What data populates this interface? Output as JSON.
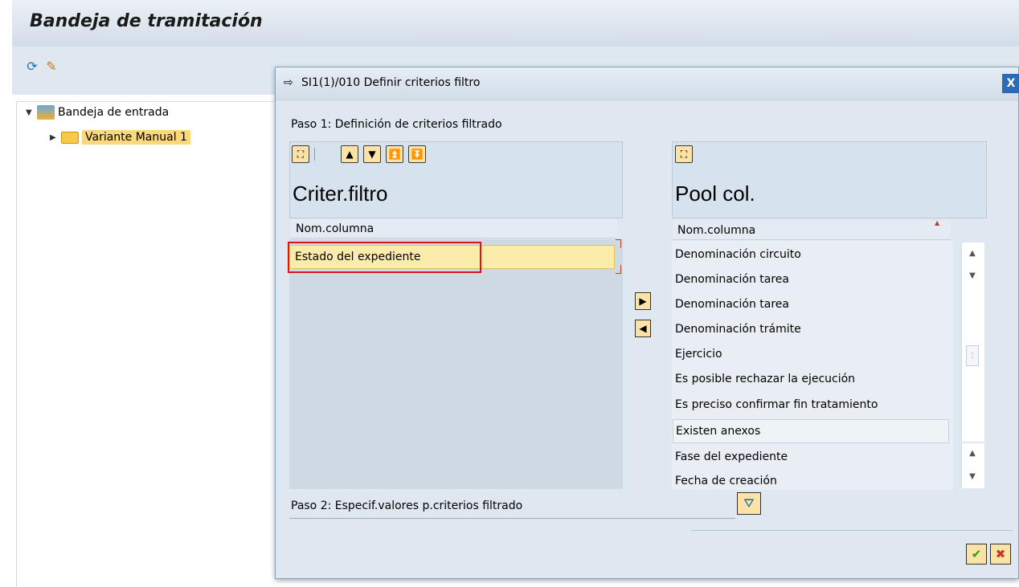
{
  "screen": {
    "title": "Bandeja de tramitación",
    "toolbar": {
      "refresh_icon": "refresh-icon",
      "edit_icon": "edit-pencil-icon"
    }
  },
  "tree": {
    "root_label": "Bandeja de entrada",
    "child_label": "Variante Manual 1"
  },
  "dialog": {
    "title": "SI1(1)/010 Definir criterios filtro",
    "close_label": "X",
    "step1_label": "Paso 1: Definición de criterios filtrado",
    "left_panel": {
      "title": "Criter.filtro",
      "column_header": "Nom.columna",
      "rows": [
        "Estado del expediente"
      ]
    },
    "right_panel": {
      "title": "Pool col.",
      "column_header": "Nom.columna",
      "rows": [
        "Denominación circuito",
        "Denominación tarea",
        "Denominación tarea",
        "Denominación trámite",
        "Ejercicio",
        "Es posible rechazar la ejecución",
        "Es preciso confirmar fin tratamiento",
        "Existen anexos",
        "Fase del expediente",
        "Fecha de creación"
      ]
    },
    "step2_label": "Paso 2: Especif.valores p.criterios filtrado",
    "colors": {
      "accent_yellow": "#fbe3a6",
      "selection_red": "#e0131a",
      "header_blue": "#d6e2ed"
    }
  }
}
